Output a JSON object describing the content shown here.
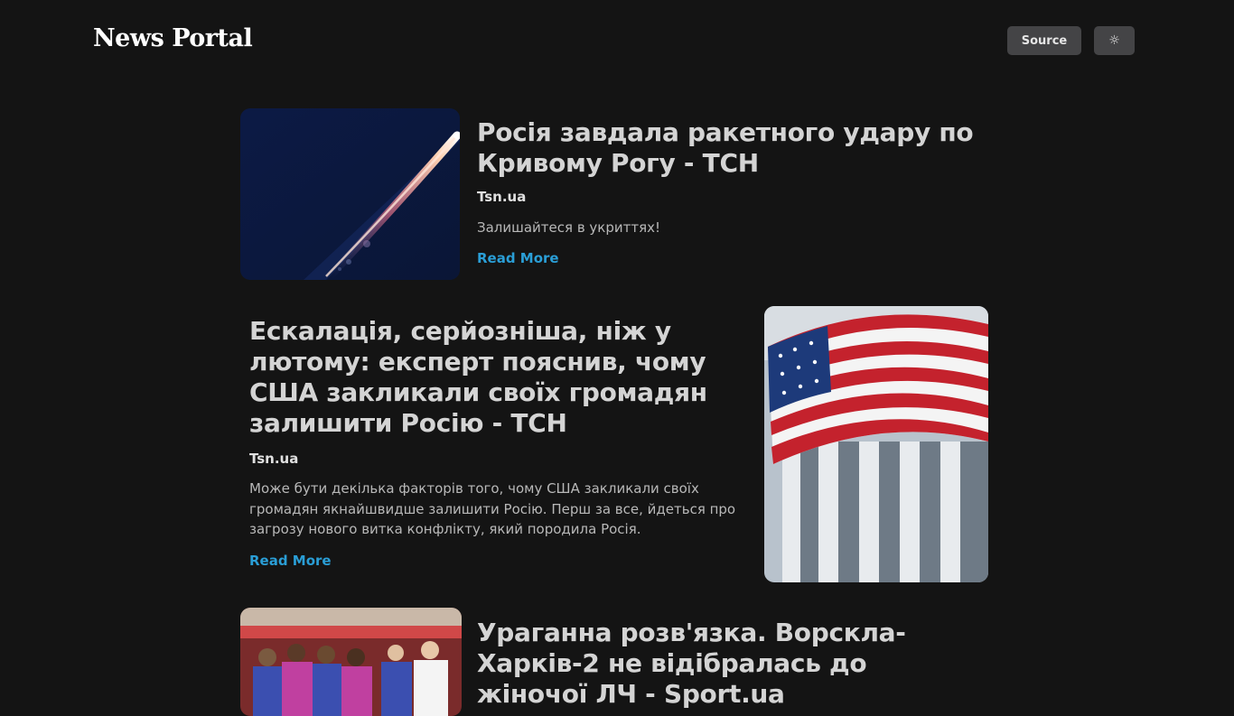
{
  "header": {
    "brand": "News Portal",
    "source_label": "Source",
    "theme_icon": "sun-icon",
    "theme_glyph": "☼"
  },
  "articles": [
    {
      "title": "Росія завдала ракетного удару по Кривому Рогу - ТСН",
      "source": "Tsn.ua",
      "description": "Залишайтеся в укриттях!",
      "read_more": "Read More",
      "image": "rocket-launch-image"
    },
    {
      "title": "Ескалація, серйозніша, ніж у лютому: експерт пояснив, чому США закликали своїх громадян залишити Росію - ТСН",
      "source": "Tsn.ua",
      "description": "Може бути декілька факторів того, чому США закликали своїх громадян якнайшвидше залишити Росію. Перш за все, йдеться про загрозу нового витка конфлікту, який породила Росія.",
      "read_more": "Read More",
      "image": "us-flag-capitol-image"
    },
    {
      "title": "Ураганна розв'язка. Ворскла-Харків-2 не відібралась до жіночої ЛЧ - Sport.ua",
      "image": "football-players-image"
    }
  ],
  "colors": {
    "background": "#141414",
    "link": "#2a9ed6",
    "button": "#444446"
  }
}
